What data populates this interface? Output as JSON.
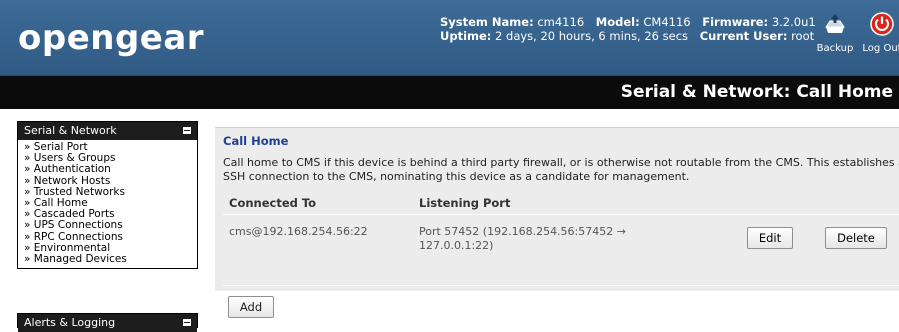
{
  "header": {
    "logo": "opengear",
    "system_name_label": "System Name:",
    "system_name": "cm4116",
    "model_label": "Model:",
    "model": "CM4116",
    "firmware_label": "Firmware:",
    "firmware": "3.2.0u1",
    "uptime_label": "Uptime:",
    "uptime": "2 days, 20 hours, 6 mins, 26 secs",
    "current_user_label": "Current User:",
    "current_user": "root",
    "backup_label": "Backup",
    "logout_label": "Log Out"
  },
  "page_title": "Serial & Network: Call Home",
  "sidebar": {
    "section1_title": "Serial & Network",
    "items": [
      "» Serial Port",
      "» Users & Groups",
      "» Authentication",
      "» Network Hosts",
      "» Trusted Networks",
      "» Call Home",
      "» Cascaded Ports",
      "» UPS Connections",
      "» RPC Connections",
      "» Environmental",
      "» Managed Devices"
    ],
    "section2_title": "Alerts & Logging"
  },
  "main": {
    "title": "Call Home",
    "desc_line1": "Call home to CMS if this device is behind a third party firewall, or is otherwise not routable from the CMS. This establishes an",
    "desc_line2": "SSH connection to the CMS, nominating this device as a candidate for management.",
    "col_connected": "Connected To",
    "col_listening": "Listening Port",
    "row": {
      "connected_to": "cms@192.168.254.56:22",
      "listening_line1": "Port 57452 (192.168.254.56:57452 →",
      "listening_line2": "127.0.0.1:22)"
    },
    "edit_label": "Edit",
    "delete_label": "Delete",
    "add_label": "Add"
  },
  "colors": {
    "header_blue": "#3e6c97",
    "title_bar": "#0b0b0b",
    "panel_bg": "#ececec",
    "heading_blue": "#1f3f8f",
    "logout_red": "#d9261c"
  }
}
